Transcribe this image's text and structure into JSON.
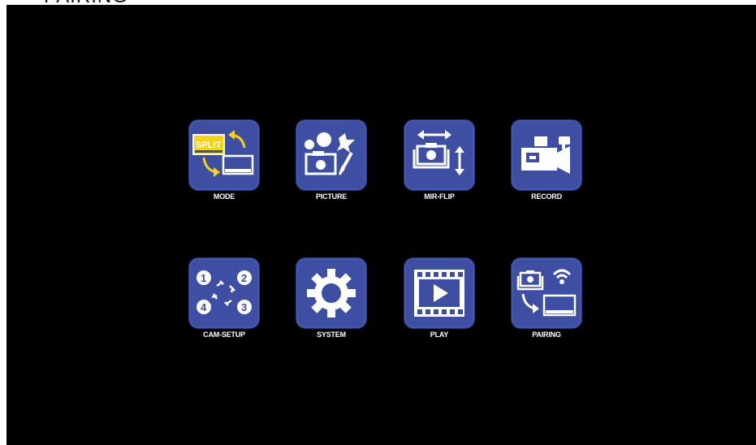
{
  "top_caption": "PAIRING",
  "menu": {
    "items": [
      {
        "label": "MODE",
        "icon": "split-mode-icon",
        "split_text": "SPLIT"
      },
      {
        "label": "PICTURE",
        "icon": "picture-icon"
      },
      {
        "label": "MIR-FLIP",
        "icon": "mirror-flip-icon"
      },
      {
        "label": "RECORD",
        "icon": "video-camera-icon"
      },
      {
        "label": "CAM-SETUP",
        "icon": "camera-setup-icon",
        "numbers": [
          "1",
          "2",
          "3",
          "4"
        ]
      },
      {
        "label": "SYSTEM",
        "icon": "gear-icon"
      },
      {
        "label": "PLAY",
        "icon": "play-icon"
      },
      {
        "label": "PAIRING",
        "icon": "pairing-icon"
      }
    ]
  },
  "colors": {
    "background": "#000000",
    "tile": "#3d4ea3",
    "accent_yellow": "#f2d21b",
    "label": "#ffffff"
  }
}
